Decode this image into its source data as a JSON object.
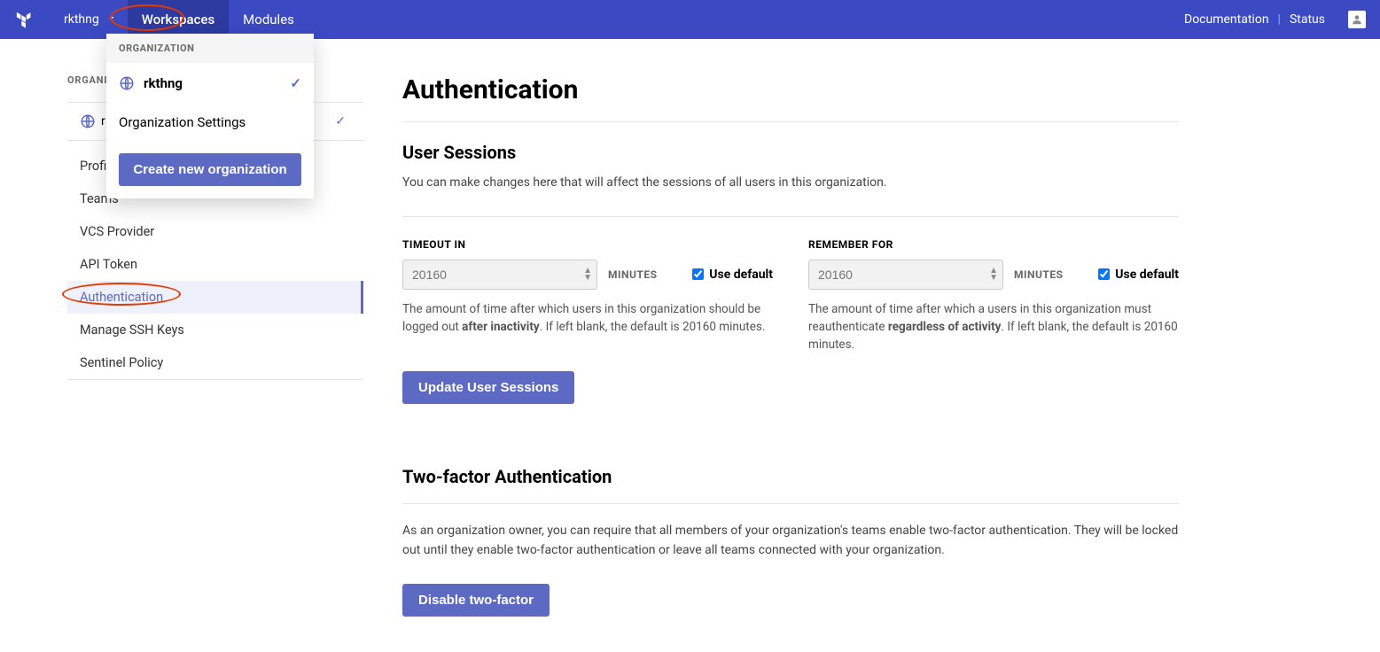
{
  "nav": {
    "org_name": "rkthng",
    "tabs": {
      "workspaces": "Workspaces",
      "modules": "Modules"
    },
    "links": {
      "documentation": "Documentation",
      "status": "Status"
    }
  },
  "dropdown": {
    "header": "ORGANIZATION",
    "selected_org": "rkthng",
    "settings_link": "Organization Settings",
    "create_button": "Create new organization"
  },
  "sidebar": {
    "header": "ORGANIZATION",
    "org_name_partial": "r",
    "items": [
      {
        "label": "Profile"
      },
      {
        "label": "Teams"
      },
      {
        "label": "VCS Provider"
      },
      {
        "label": "API Token"
      },
      {
        "label": "Authentication"
      },
      {
        "label": "Manage SSH Keys"
      },
      {
        "label": "Sentinel Policy"
      }
    ]
  },
  "page": {
    "title": "Authentication",
    "user_sessions": {
      "heading": "User Sessions",
      "intro": "You can make changes here that will affect the sessions of all users in this organization.",
      "timeout": {
        "label": "TIMEOUT IN",
        "placeholder": "20160",
        "unit": "MINUTES",
        "use_default": "Use default",
        "help_pre": "The amount of time after which users in this organization should be logged out ",
        "help_bold": "after inactivity",
        "help_post": ". If left blank, the default is 20160 minutes."
      },
      "remember": {
        "label": "REMEMBER FOR",
        "placeholder": "20160",
        "unit": "MINUTES",
        "use_default": "Use default",
        "help_pre": "The amount of time after which a users in this organization must reauthenticate ",
        "help_bold": "regardless of activity",
        "help_post": ". If left blank, the default is 20160 minutes."
      },
      "update_button": "Update User Sessions"
    },
    "twofa": {
      "heading": "Two-factor Authentication",
      "intro": "As an organization owner, you can require that all members of your organization's teams enable two-factor authentication. They will be locked out until they enable two-factor authentication or leave all teams connected with your organization.",
      "disable_button": "Disable two-factor"
    }
  }
}
